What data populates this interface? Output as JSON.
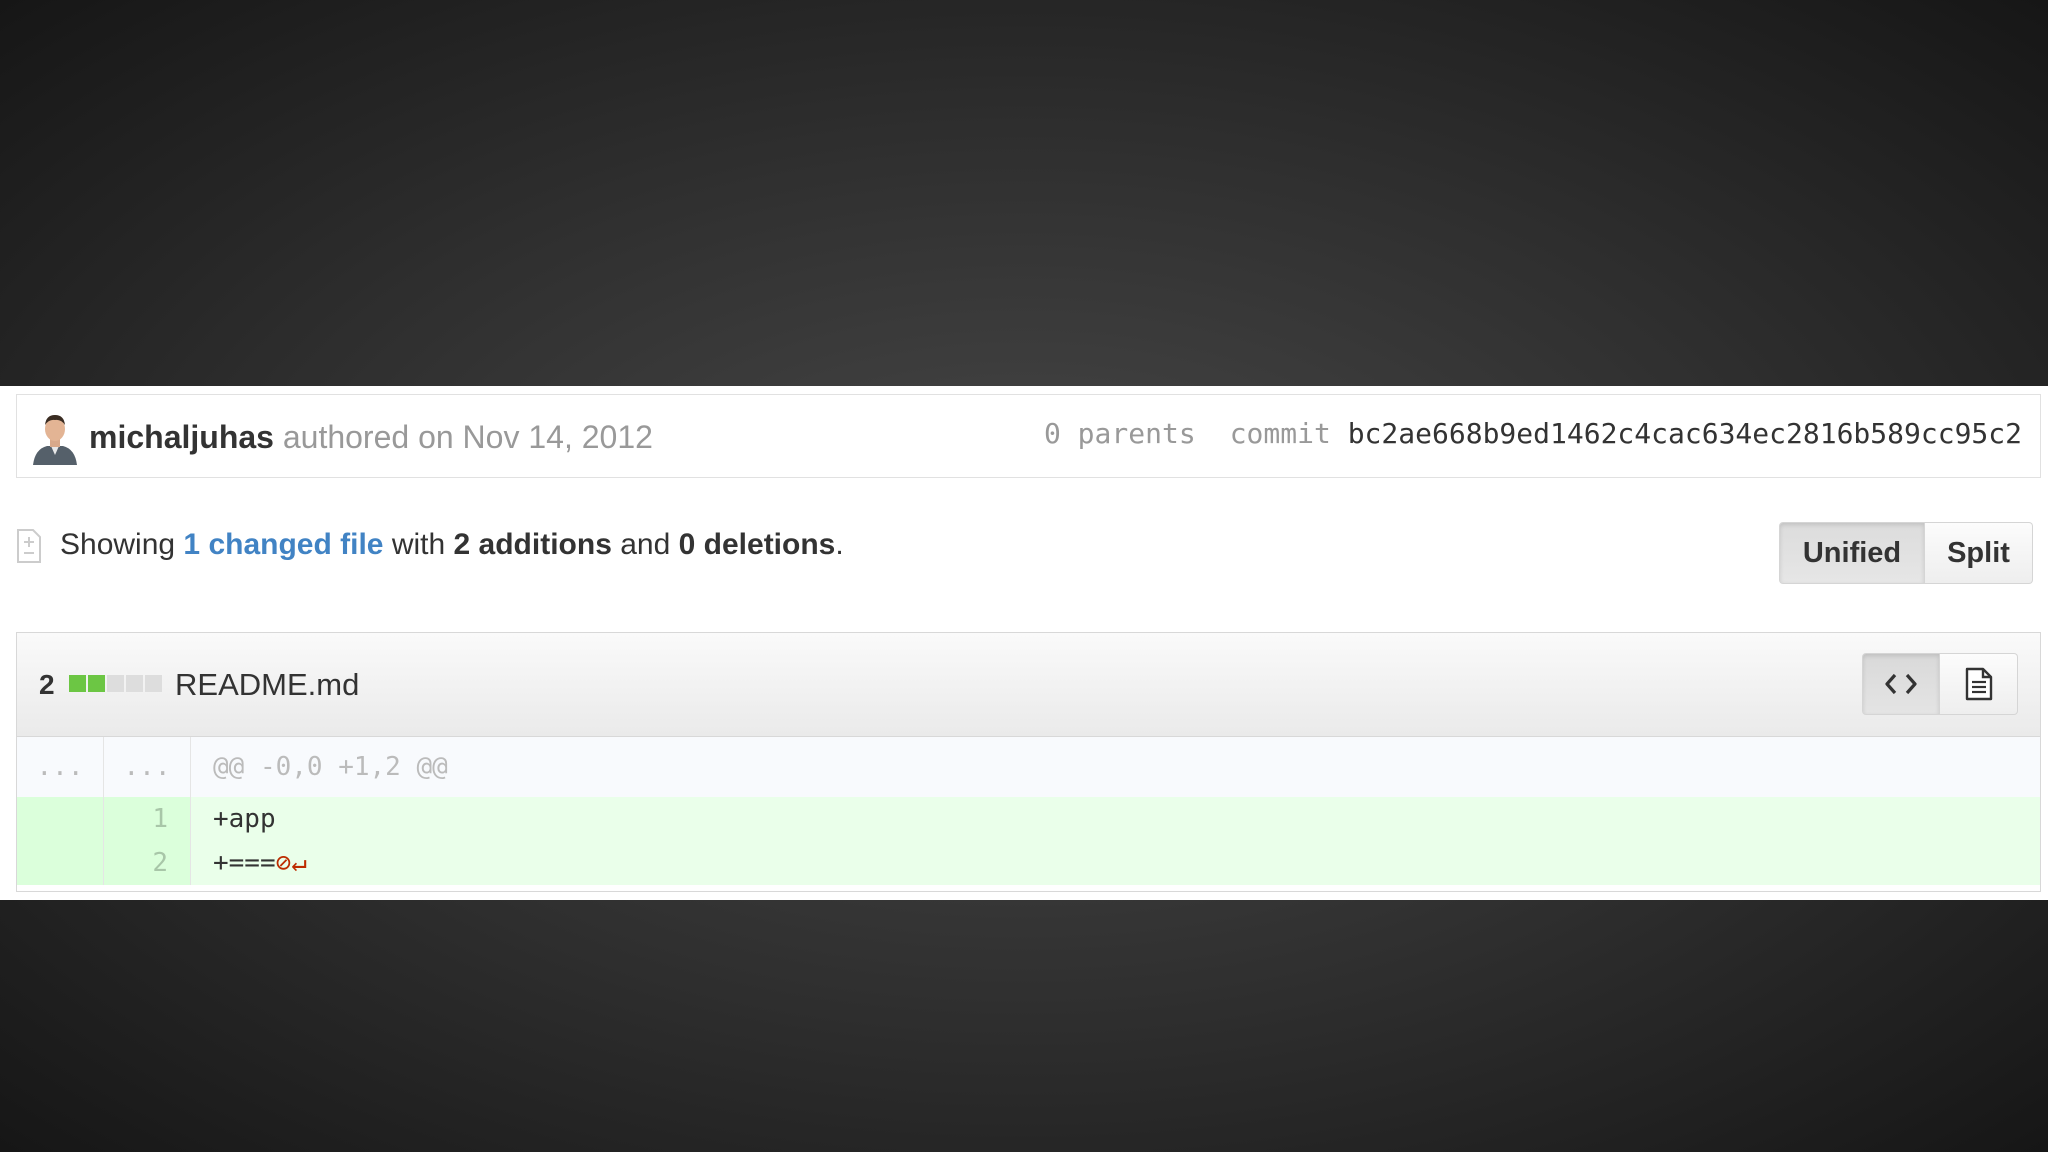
{
  "commit": {
    "author": "michaljuhas",
    "authored_text": "authored on Nov 14, 2012",
    "parents_text": "0 parents",
    "commit_label": "commit",
    "sha": "bc2ae668b9ed1462c4cac634ec2816b589cc95c2"
  },
  "toc": {
    "showing": "Showing",
    "changed_files_link": "1 changed file",
    "with": "with",
    "additions": "2 additions",
    "and": "and",
    "deletions": "0 deletions",
    "period": "."
  },
  "view_toggle": {
    "unified_label": "Unified",
    "split_label": "Split",
    "selected": "Unified"
  },
  "file": {
    "diffstat_count": "2",
    "diffstat_blocks": [
      "added",
      "added",
      "neutral",
      "neutral",
      "neutral"
    ],
    "name": "README.md",
    "actions": [
      {
        "icon": "code-icon",
        "selected": true
      },
      {
        "icon": "file-text-icon",
        "selected": false
      }
    ],
    "hunk": {
      "old_num": "...",
      "new_num": "...",
      "header": "@@ -0,0 +1,2 @@"
    },
    "lines": [
      {
        "old_num": "",
        "new_num": "1",
        "code": "+app",
        "no_newline": false
      },
      {
        "old_num": "",
        "new_num": "2",
        "code": "+===",
        "no_newline": true
      }
    ]
  },
  "colors": {
    "link": "#4183c4",
    "added_block": "#6cc644",
    "neutral_block": "#dddddd",
    "added_row": "#eaffea",
    "no_newline_marker": "#bd2c00"
  }
}
